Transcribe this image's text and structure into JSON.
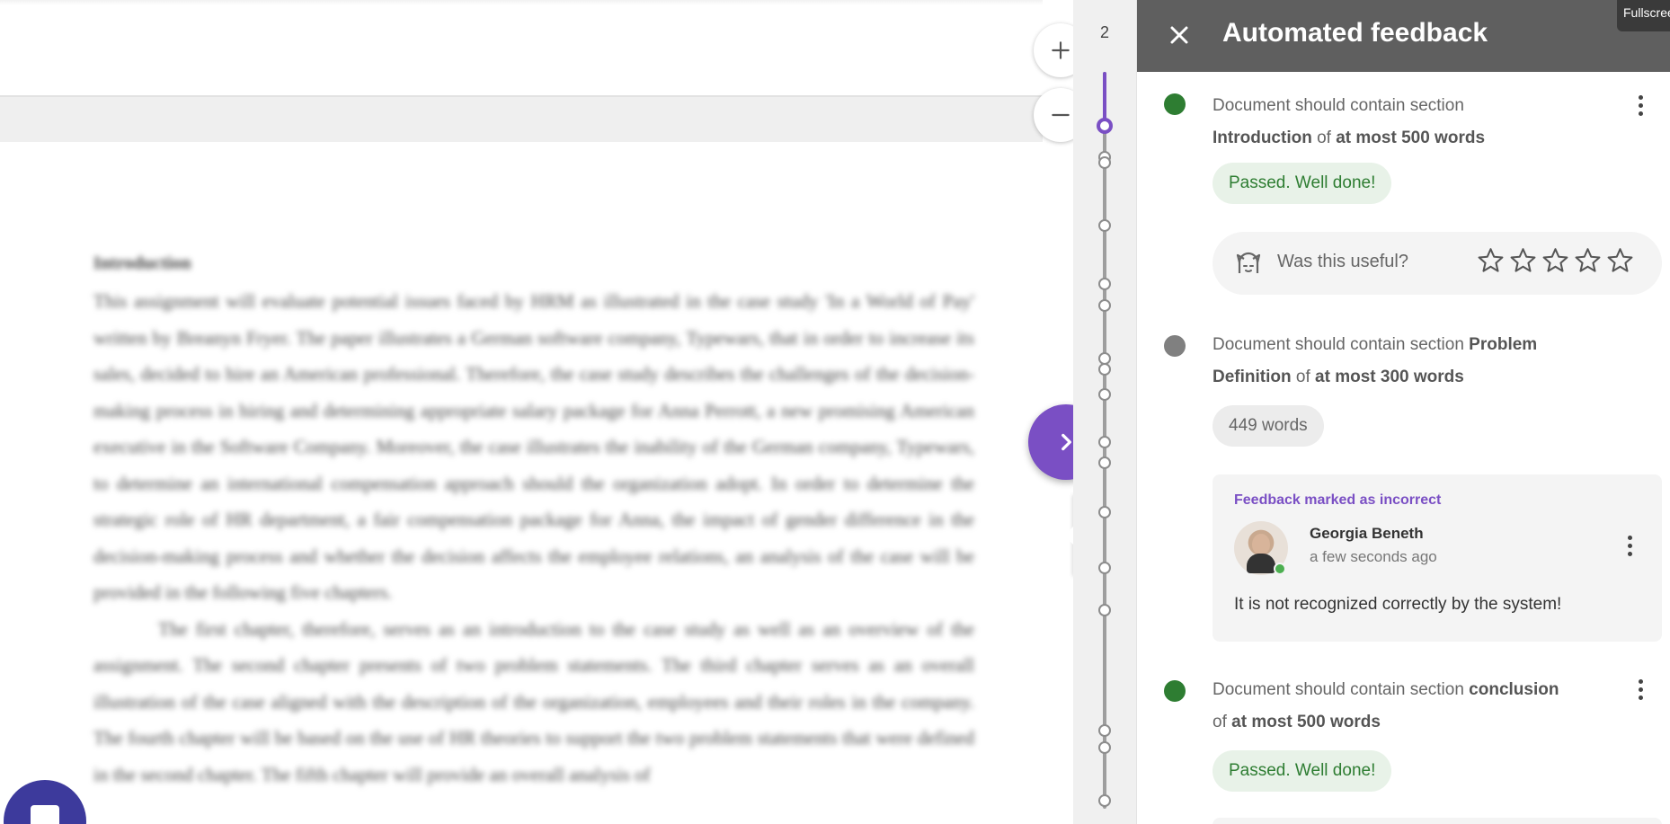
{
  "document": {
    "heading": "Introduction",
    "paragraph_1": "This assignment will evaluate potential issues faced by HRM as illustrated in the case study 'In a World of Pay' written by Breanyn Fryer. The paper illustrates a German software company, Typewars, that in order to increase its sales, decided to hire an American professional. Therefore, the case study describes the challenges of the decision-making process in hiring and determining appropriate salary package for Anna Perrott, a new promising American executive in the Software Company. Moreover, the case illustrates the inability of the German company, Typewars, to determine an international compensation approach should the organization adopt. In order to determine the strategic role of HR department, a fair compensation package for Anna, the impact of gender difference in the decision-making process and whether the decision affects the employee relations, an analysis of the case will be provided in the following five chapters.",
    "paragraph_2": "The first chapter, therefore, serves as an introduction to the case study as well as an overview of the assignment. The second chapter presents of two problem statements. The third chapter serves as an overall illustration of the case aligned with the description of the organization, employees and their roles in the company. The fourth chapter will be based on the use of HR theories to support the two problem statements that were defined in the second chapter. The fifth chapter will provide an overall analysis of"
  },
  "timeline": {
    "page_number": "2"
  },
  "panel": {
    "title": "Automated feedback",
    "fullscreen_label": "Fullscreen",
    "items": [
      {
        "status": "passed",
        "text_prefix": "Document should contain section",
        "section": "Introduction",
        "text_mid": "of",
        "limit": "at most 500 words",
        "chip": "Passed. Well done!"
      },
      {
        "status": "pending",
        "text_prefix": "Document should contain section",
        "section": "Problem Definition",
        "text_mid": "of",
        "limit": "at most 300 words",
        "chip": "449 words"
      },
      {
        "status": "passed",
        "text_prefix": "Document should contain section",
        "section": "conclusion",
        "text_mid": "of",
        "limit": "at most 500 words",
        "chip": "Passed. Well done!"
      }
    ],
    "useful": {
      "label": "Was this useful?",
      "rating": 0,
      "max": 5
    },
    "comment": {
      "flag": "Feedback marked as incorrect",
      "author": "Georgia Beneth",
      "time": "a few seconds ago",
      "body": "It is not recognized correctly by the system!"
    }
  },
  "colors": {
    "accent": "#7a4fc4",
    "passed": "#2e7d32",
    "pending": "#808080",
    "header": "#5f5f5f"
  }
}
